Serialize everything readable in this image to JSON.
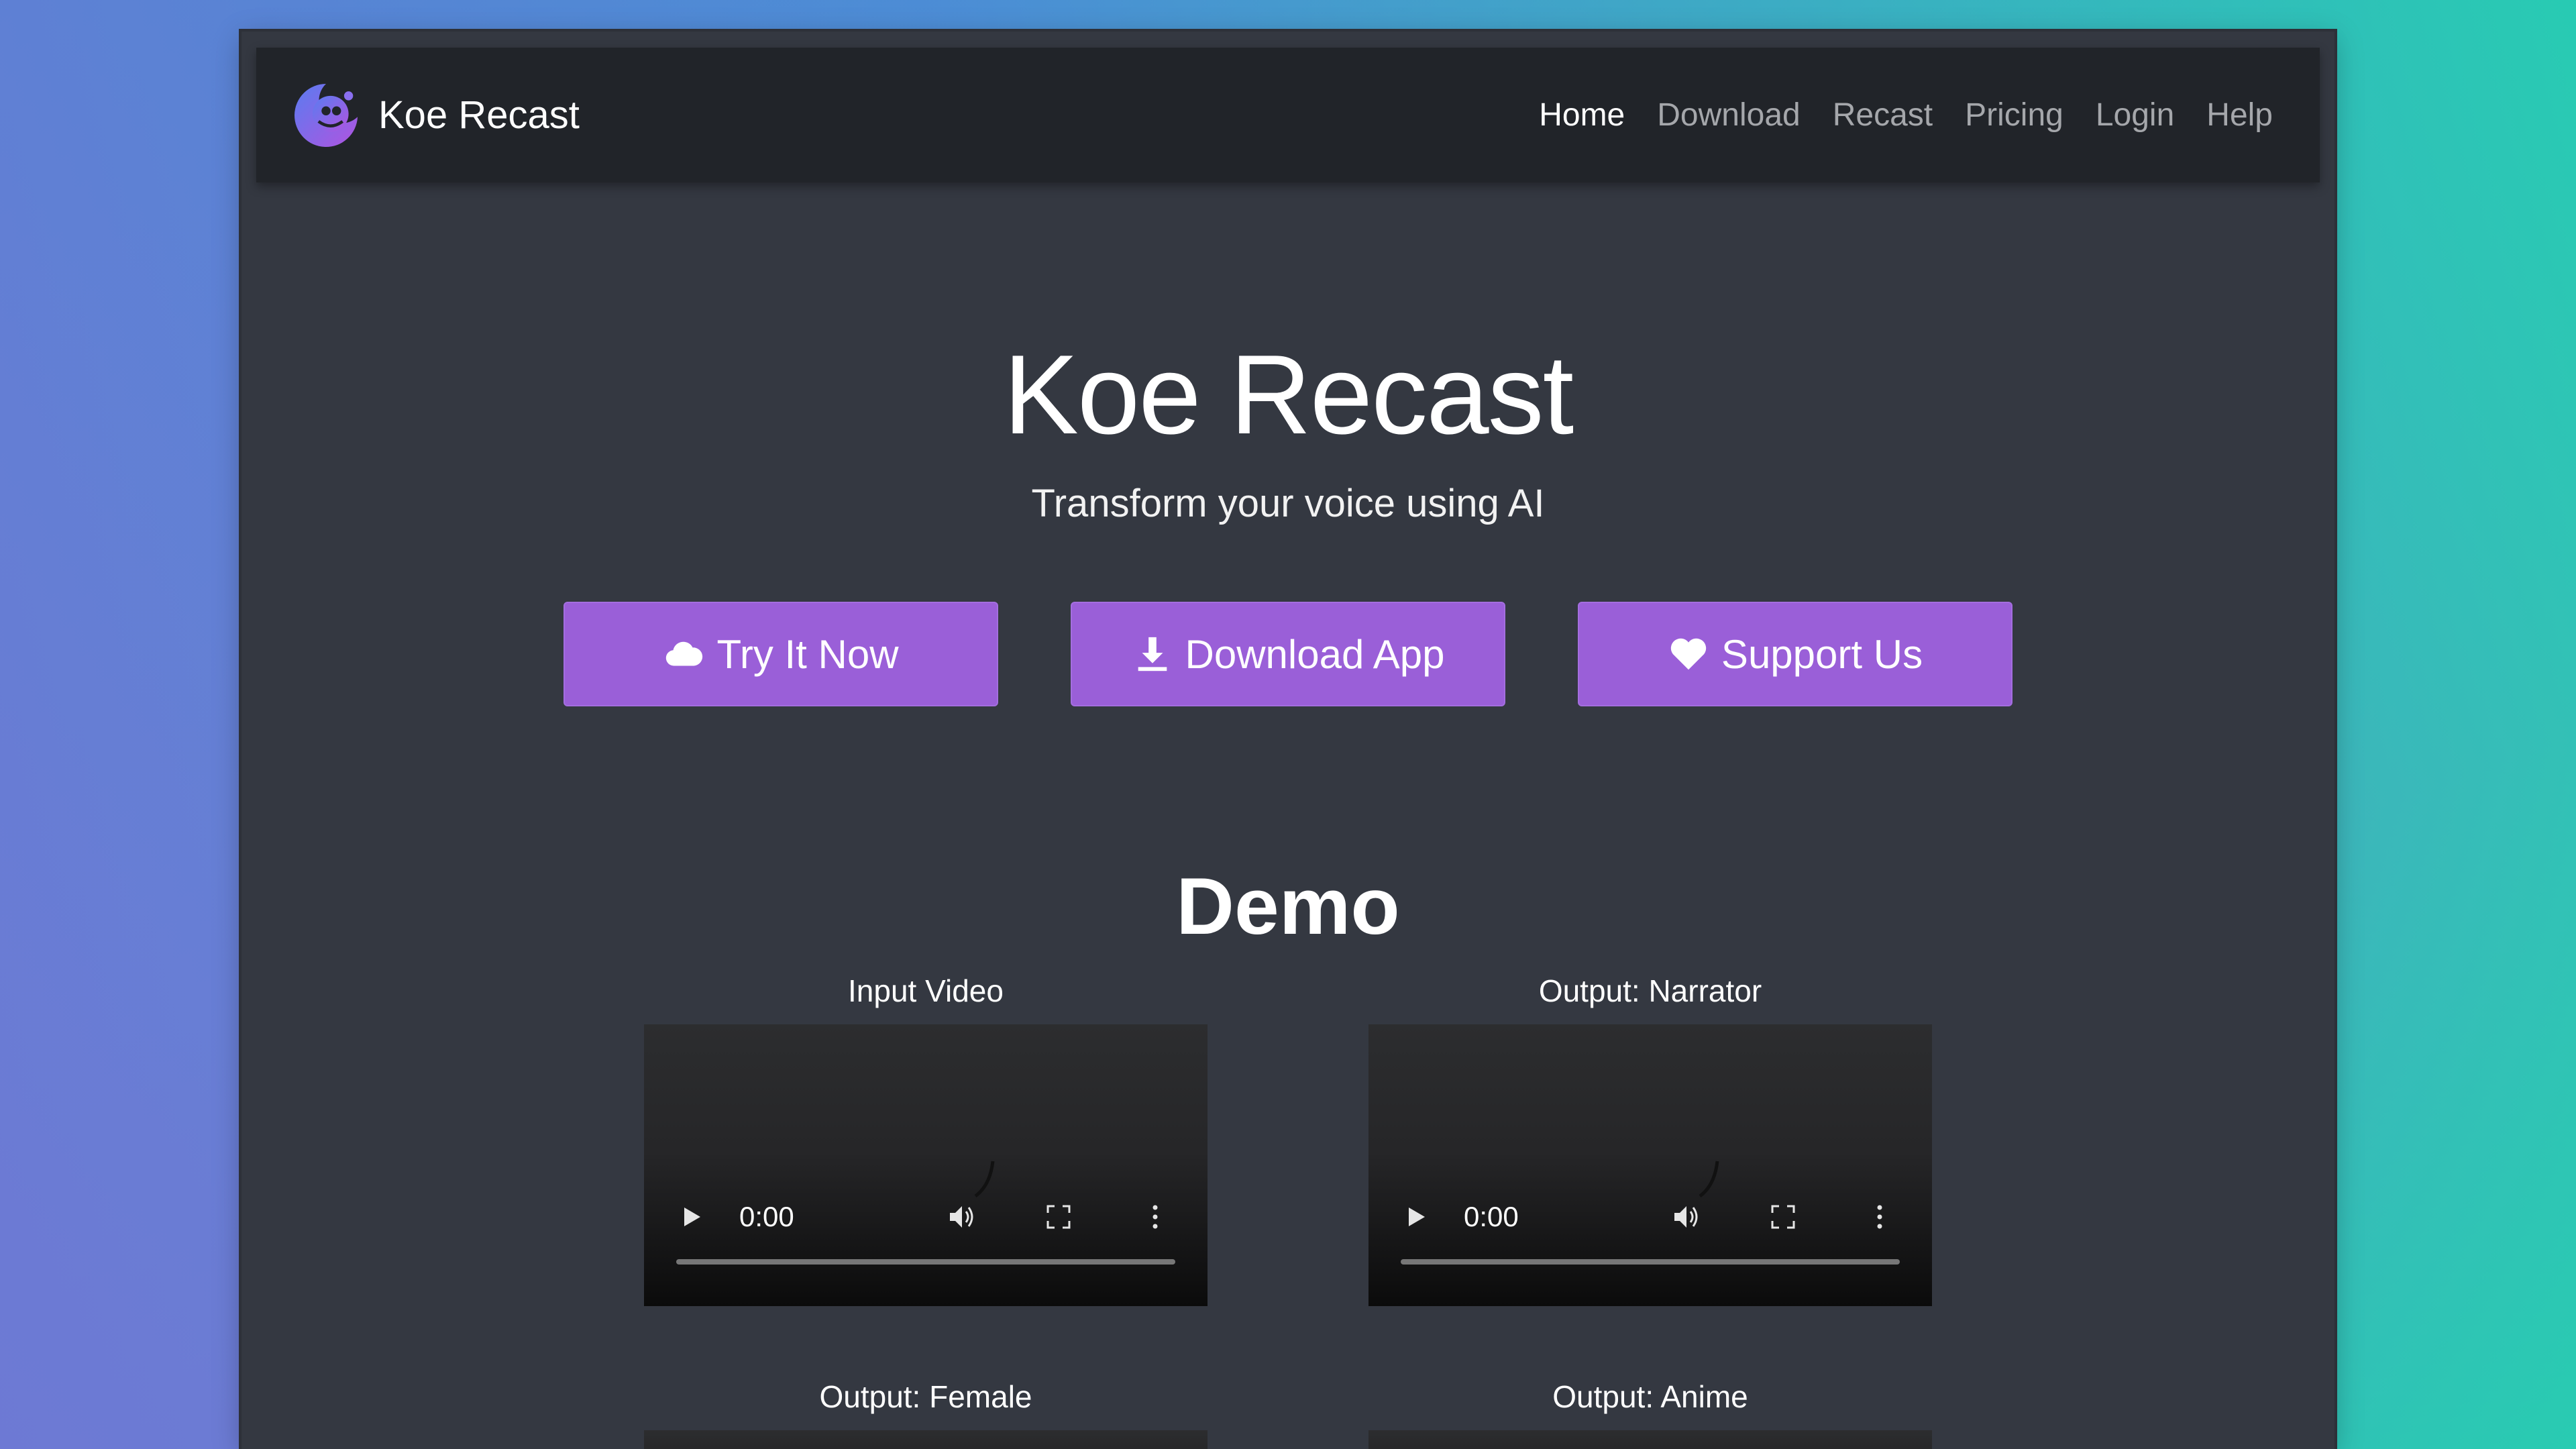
{
  "nav": {
    "brand": "Koe Recast",
    "links": [
      {
        "label": "Home",
        "active": true
      },
      {
        "label": "Download",
        "active": false
      },
      {
        "label": "Recast",
        "active": false
      },
      {
        "label": "Pricing",
        "active": false
      },
      {
        "label": "Login",
        "active": false
      },
      {
        "label": "Help",
        "active": false
      }
    ]
  },
  "hero": {
    "title": "Koe Recast",
    "subtitle": "Transform your voice using AI"
  },
  "buttons": {
    "try": {
      "label": "Try It Now",
      "icon": "cloud-icon"
    },
    "download": {
      "label": "Download App",
      "icon": "download-icon"
    },
    "support": {
      "label": "Support Us",
      "icon": "heart-icon"
    }
  },
  "demo": {
    "title": "Demo",
    "videos": [
      {
        "label": "Input Video",
        "time": "0:00"
      },
      {
        "label": "Output: Narrator",
        "time": "0:00"
      },
      {
        "label": "Output: Female"
      },
      {
        "label": "Output: Anime"
      }
    ]
  },
  "colors": {
    "accent": "#9a5fd8",
    "navbar": "#212429",
    "page": "#343841"
  }
}
